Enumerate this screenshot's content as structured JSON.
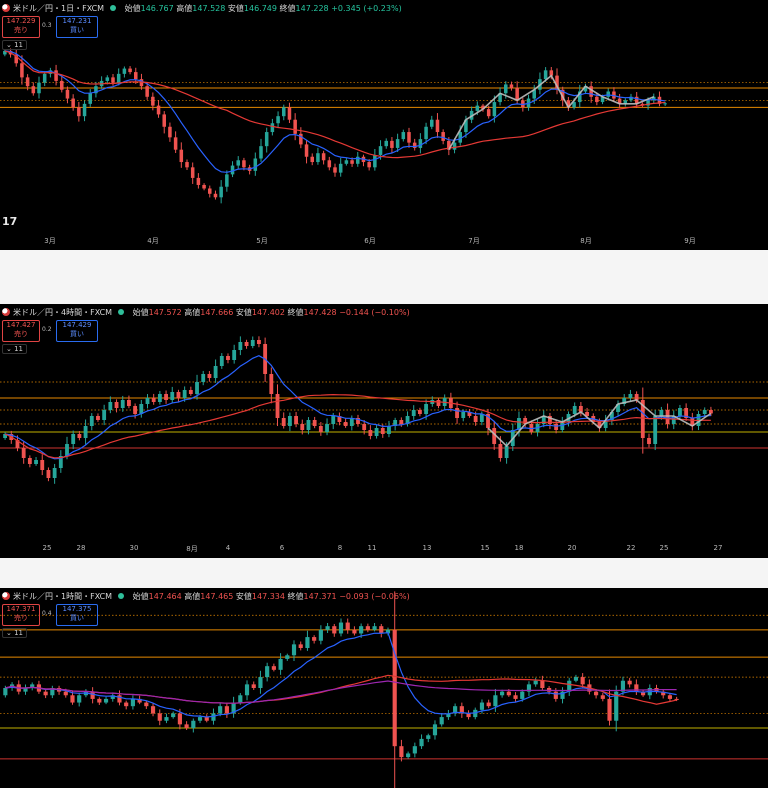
{
  "panels": [
    {
      "title": "米ドル／円・1日・FXCM",
      "o_label": "始値",
      "o": "146.767",
      "h_label": "高値",
      "h": "147.528",
      "l_label": "安値",
      "l": "146.749",
      "c_label": "終値",
      "c": "147.228",
      "change": "+0.345 (+0.23%)",
      "change_dir": "up",
      "sell_price": "147.229",
      "sell_label": "売り",
      "buy_price": "147.231",
      "buy_label": "買い",
      "spread": "0.3",
      "indicator_count": "11",
      "logo_text": "17",
      "ticks": [
        "3月",
        "4月",
        "5月",
        "6月",
        "7月",
        "8月",
        "9月"
      ]
    },
    {
      "title": "米ドル／円・4時間・FXCM",
      "o_label": "始値",
      "o": "147.572",
      "h_label": "高値",
      "h": "147.666",
      "l_label": "安値",
      "l": "147.402",
      "c_label": "終値",
      "c": "147.428",
      "change": "−0.144 (−0.10%)",
      "change_dir": "down",
      "sell_price": "147.427",
      "sell_label": "売り",
      "buy_price": "147.429",
      "buy_label": "買い",
      "spread": "0.2",
      "indicator_count": "11",
      "ticks": [
        "25",
        "28",
        "30",
        "8月",
        "4",
        "6",
        "8",
        "11",
        "13",
        "15",
        "18",
        "20",
        "22",
        "25",
        "27"
      ]
    },
    {
      "title": "米ドル／円・1時間・FXCM",
      "o_label": "始値",
      "o": "147.464",
      "h_label": "高値",
      "h": "147.465",
      "l_label": "安値",
      "l": "147.334",
      "c_label": "終値",
      "c": "147.371",
      "change": "−0.093 (−0.06%)",
      "change_dir": "down",
      "sell_price": "147.371",
      "sell_label": "売り",
      "buy_price": "147.375",
      "buy_label": "買い",
      "spread": "0.4",
      "indicator_count": "11",
      "ticks": []
    }
  ],
  "colors": {
    "up": "#26a69a",
    "down": "#ef5350",
    "ma_fast": "#2962ff",
    "ma_slow": "#e53935",
    "ma_long": "#9c27b0",
    "zigzag": "#bdbdbd",
    "level_orange": "#ff9800",
    "level_red": "#e53935",
    "level_yellow": "#d4c200"
  },
  "chart_data": [
    {
      "type": "candlestick",
      "timeframe": "1日",
      "ylim": [
        140.5,
        151.5
      ],
      "closes": [
        150.2,
        150.0,
        149.5,
        148.7,
        148.2,
        147.8,
        148.4,
        148.9,
        149.1,
        148.5,
        148.0,
        147.5,
        147.0,
        146.5,
        147.2,
        147.8,
        148.2,
        148.5,
        148.7,
        148.4,
        148.9,
        149.2,
        149.0,
        148.6,
        148.2,
        147.6,
        147.1,
        146.6,
        145.9,
        145.3,
        144.6,
        143.9,
        143.6,
        143.0,
        142.6,
        142.4,
        142.1,
        141.9,
        142.5,
        143.2,
        143.7,
        144.0,
        143.6,
        143.4,
        144.1,
        144.8,
        145.6,
        146.1,
        146.5,
        147.0,
        146.3,
        145.5,
        144.9,
        144.2,
        143.9,
        144.4,
        144.0,
        143.6,
        143.3,
        143.8,
        144.0,
        143.8,
        144.2,
        143.9,
        143.6,
        144.3,
        144.8,
        145.1,
        144.7,
        145.2,
        145.6,
        145.0,
        144.7,
        145.2,
        145.9,
        146.3,
        145.6,
        145.1,
        144.6,
        145.0,
        145.6,
        146.3,
        146.8,
        147.1,
        146.9,
        146.5,
        147.3,
        147.8,
        148.3,
        148.1,
        147.4,
        147.0,
        147.5,
        148.0,
        148.6,
        149.1,
        148.8,
        148.0,
        147.4,
        147.0,
        147.3,
        147.9,
        148.2,
        147.6,
        147.3,
        147.6,
        147.9,
        147.5,
        147.2,
        147.4,
        147.6,
        147.2,
        147.1,
        147.4,
        147.6,
        147.2,
        147.228
      ],
      "levels": [
        {
          "value": 148.1,
          "color": "level_orange",
          "style": "solid"
        },
        {
          "value": 147.0,
          "color": "level_orange",
          "style": "solid"
        },
        {
          "value": 148.4,
          "color": "level_orange",
          "style": "dotted"
        },
        {
          "value": 147.4,
          "color": "level_orange",
          "style": "dotted"
        }
      ],
      "ma": [
        "ma_fast",
        "ma_slow"
      ],
      "zigzag_from": 78
    },
    {
      "type": "candlestick",
      "timeframe": "4時間",
      "ylim": [
        142.0,
        151.6
      ],
      "closes": [
        146.4,
        146.1,
        145.7,
        145.2,
        144.9,
        145.1,
        144.6,
        144.2,
        144.7,
        145.3,
        145.9,
        146.4,
        146.2,
        146.8,
        147.3,
        147.1,
        147.6,
        148.0,
        147.7,
        148.1,
        147.8,
        147.4,
        147.9,
        148.2,
        148.0,
        148.4,
        148.1,
        148.5,
        148.2,
        148.6,
        148.4,
        149.0,
        149.4,
        149.2,
        149.8,
        150.3,
        150.1,
        150.6,
        151.0,
        150.8,
        151.1,
        150.9,
        149.4,
        148.4,
        147.2,
        146.8,
        147.3,
        146.9,
        146.6,
        147.1,
        146.8,
        146.5,
        146.9,
        147.3,
        147.0,
        146.8,
        147.2,
        146.9,
        146.6,
        146.3,
        146.7,
        146.4,
        146.8,
        147.1,
        146.9,
        147.3,
        147.6,
        147.4,
        147.9,
        148.1,
        147.8,
        148.2,
        147.7,
        147.2,
        147.5,
        147.3,
        147.0,
        147.4,
        146.7,
        145.9,
        145.2,
        145.8,
        146.6,
        147.2,
        146.9,
        146.5,
        146.9,
        147.3,
        146.9,
        146.6,
        147.0,
        147.4,
        147.8,
        147.5,
        147.3,
        147.0,
        146.7,
        147.1,
        147.5,
        147.9,
        148.2,
        148.4,
        148.1,
        146.2,
        145.9,
        147.3,
        147.6,
        146.9,
        147.3,
        147.7,
        147.2,
        146.8,
        147.4,
        147.6,
        147.428
      ],
      "levels": [
        {
          "value": 148.2,
          "color": "level_orange",
          "style": "solid"
        },
        {
          "value": 146.5,
          "color": "level_yellow",
          "style": "solid"
        },
        {
          "value": 145.7,
          "color": "level_red",
          "style": "solid"
        },
        {
          "value": 147.6,
          "color": "level_orange",
          "style": "dotted"
        },
        {
          "value": 146.9,
          "color": "level_orange",
          "style": "dotted"
        },
        {
          "value": 149.0,
          "color": "level_orange",
          "style": "dotted"
        }
      ],
      "ma": [
        "ma_fast",
        "ma_slow"
      ],
      "zigzag_from": 78
    },
    {
      "type": "candlestick",
      "timeframe": "1時間",
      "ylim": [
        145.5,
        149.9
      ],
      "closes": [
        147.7,
        147.8,
        147.6,
        147.7,
        147.8,
        147.6,
        147.5,
        147.7,
        147.6,
        147.5,
        147.3,
        147.5,
        147.6,
        147.4,
        147.3,
        147.4,
        147.5,
        147.3,
        147.2,
        147.4,
        147.3,
        147.2,
        147.0,
        146.8,
        146.9,
        147.0,
        146.7,
        146.6,
        146.8,
        146.9,
        146.8,
        147.0,
        147.2,
        147.0,
        147.3,
        147.5,
        147.8,
        147.7,
        148.0,
        148.3,
        148.2,
        148.5,
        148.6,
        148.9,
        148.8,
        149.1,
        149.0,
        149.3,
        149.4,
        149.2,
        149.5,
        149.3,
        149.2,
        149.4,
        149.3,
        149.4,
        149.2,
        149.3,
        146.1,
        145.8,
        145.9,
        146.1,
        146.3,
        146.4,
        146.7,
        146.9,
        147.0,
        147.2,
        147.0,
        146.9,
        147.1,
        147.3,
        147.2,
        147.5,
        147.6,
        147.5,
        147.4,
        147.6,
        147.8,
        147.9,
        147.7,
        147.6,
        147.4,
        147.6,
        147.9,
        148.0,
        147.8,
        147.6,
        147.5,
        147.4,
        146.8,
        147.6,
        147.9,
        147.8,
        147.6,
        147.5,
        147.7,
        147.6,
        147.5,
        147.4,
        147.371
      ],
      "levels": [
        {
          "value": 149.3,
          "color": "level_orange",
          "style": "solid"
        },
        {
          "value": 148.55,
          "color": "level_orange",
          "style": "solid"
        },
        {
          "value": 146.6,
          "color": "level_yellow",
          "style": "solid"
        },
        {
          "value": 145.75,
          "color": "level_red",
          "style": "solid"
        },
        {
          "value": 148.0,
          "color": "level_orange",
          "style": "dotted"
        },
        {
          "value": 147.0,
          "color": "level_orange",
          "style": "dotted"
        },
        {
          "value": 149.7,
          "color": "level_orange",
          "style": "dotted"
        }
      ],
      "ma": [
        "ma_fast",
        "ma_slow",
        "ma_long"
      ],
      "zigzag_from": 999
    }
  ]
}
